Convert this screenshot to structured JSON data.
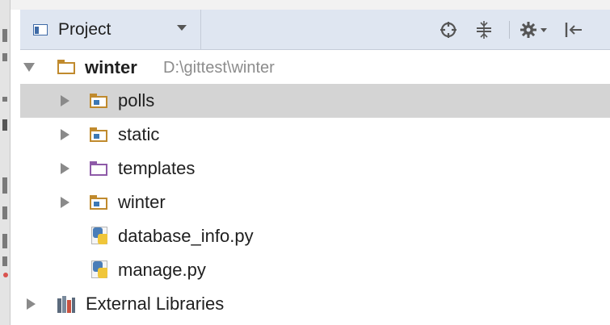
{
  "header": {
    "view_title": "Project",
    "buttons": [
      {
        "name": "locate-icon"
      },
      {
        "name": "collapse-all-icon"
      },
      {
        "name": "settings-icon"
      },
      {
        "name": "hide-icon"
      }
    ]
  },
  "tree": {
    "root": {
      "label": "winter",
      "path": "D:\\gittest\\winter",
      "expanded": true
    },
    "items": [
      {
        "label": "polls",
        "type": "folder",
        "selected": true,
        "expandable": true
      },
      {
        "label": "static",
        "type": "folder",
        "selected": false,
        "expandable": true
      },
      {
        "label": "templates",
        "type": "templates-folder",
        "selected": false,
        "expandable": true
      },
      {
        "label": "winter",
        "type": "folder",
        "selected": false,
        "expandable": true
      },
      {
        "label": "database_info.py",
        "type": "python-file",
        "selected": false,
        "expandable": false
      },
      {
        "label": "manage.py",
        "type": "python-file",
        "selected": false,
        "expandable": false
      }
    ],
    "external": {
      "label": "External Libraries",
      "expandable": true
    }
  },
  "colors": {
    "header_bg": "#dfe6f1",
    "selection": "#d4d4d4",
    "folder": "#c08a2d",
    "templates_folder": "#8e5aa8",
    "path_text": "#8c8c8c"
  }
}
